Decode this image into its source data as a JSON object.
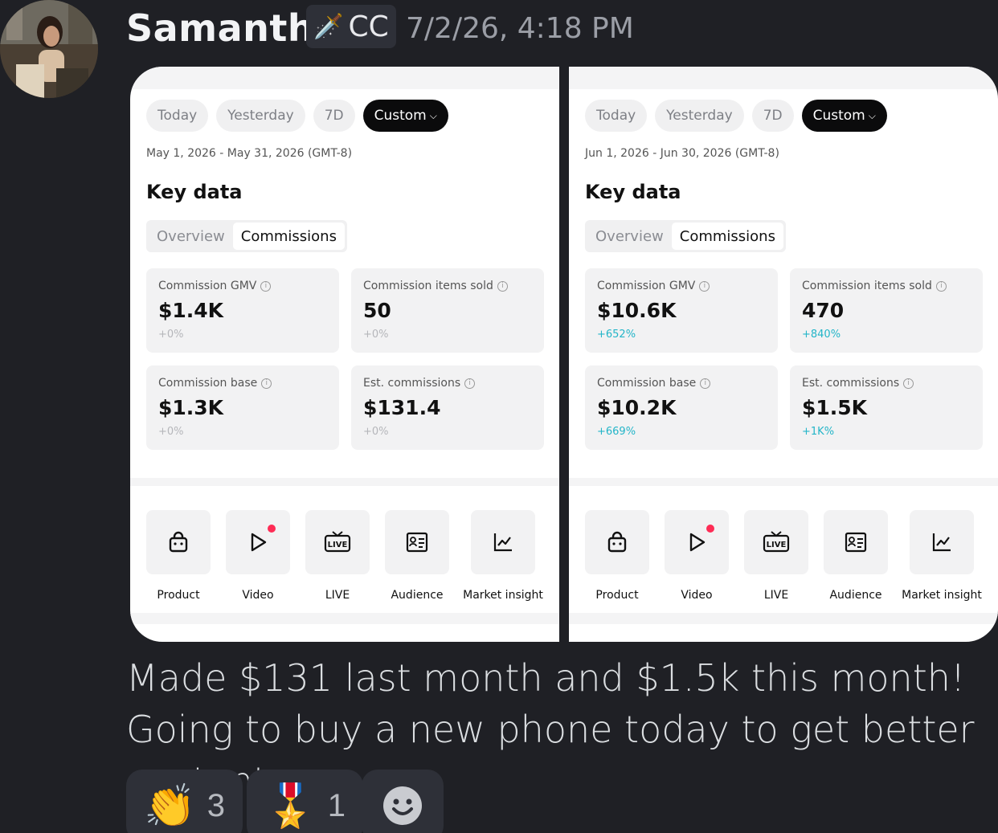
{
  "message": {
    "author": "Samantha",
    "role_tag": "CC",
    "role_icon": "sword-icon",
    "timestamp": "7/2/26, 4:18 PM",
    "text": "Made $131 last month and $1.5k this month! Going to buy a new phone today to get better content"
  },
  "screenshots": [
    {
      "date_pills": [
        "Today",
        "Yesterday",
        "7D",
        "Custom"
      ],
      "active_pill": "Custom",
      "date_range": "May 1, 2026 - May 31, 2026 (GMT-8)",
      "section_title": "Key data",
      "segments": [
        "Overview",
        "Commissions"
      ],
      "active_segment": "Commissions",
      "metrics": [
        {
          "label": "Commission GMV",
          "value": "$1.4K",
          "delta": "+0%"
        },
        {
          "label": "Commission items sold",
          "value": "50",
          "delta": "+0%"
        },
        {
          "label": "Commission base",
          "value": "$1.3K",
          "delta": "+0%"
        },
        {
          "label": "Est. commissions",
          "value": "$131.4",
          "delta": "+0%"
        }
      ],
      "tools": [
        "Product",
        "Video",
        "LIVE",
        "Audience",
        "Market insight"
      ]
    },
    {
      "date_pills": [
        "Today",
        "Yesterday",
        "7D",
        "Custom"
      ],
      "active_pill": "Custom",
      "date_range": "Jun 1, 2026 - Jun 30, 2026 (GMT-8)",
      "section_title": "Key data",
      "segments": [
        "Overview",
        "Commissions"
      ],
      "active_segment": "Commissions",
      "metrics": [
        {
          "label": "Commission GMV",
          "value": "$10.6K",
          "delta": "+652%"
        },
        {
          "label": "Commission items sold",
          "value": "470",
          "delta": "+840%"
        },
        {
          "label": "Commission base",
          "value": "$10.2K",
          "delta": "+669%"
        },
        {
          "label": "Est. commissions",
          "value": "$1.5K",
          "delta": "+1K%"
        }
      ],
      "tools": [
        "Product",
        "Video",
        "LIVE",
        "Audience",
        "Market insight"
      ]
    }
  ],
  "reactions": [
    {
      "emoji": "👏",
      "count": "3"
    },
    {
      "emoji": "🎖️",
      "count": "1"
    }
  ],
  "colors": {
    "background": "#1f2025",
    "positive_delta": "#23b5c8",
    "active_pill": "#0b0b0c",
    "video_badge": "#fe2c55"
  }
}
